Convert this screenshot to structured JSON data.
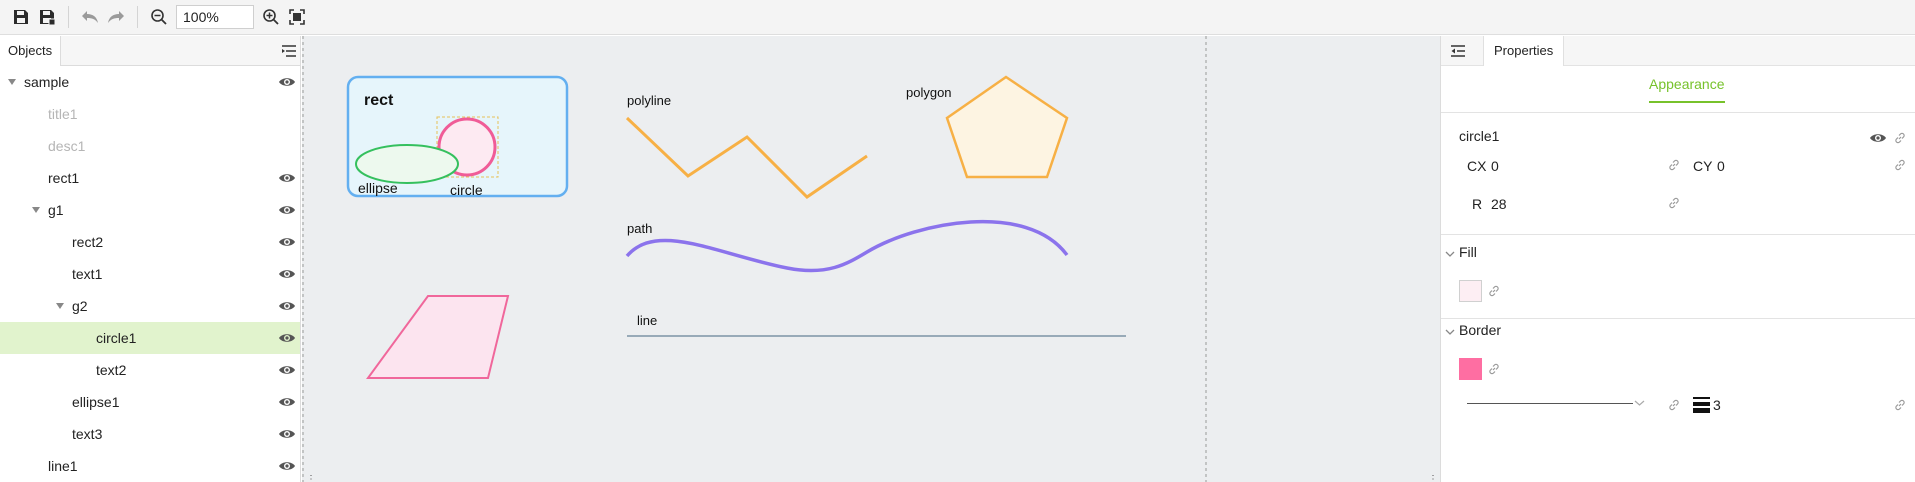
{
  "toolbar": {
    "zoom_value": "100%",
    "icons": [
      "save-icon",
      "save-as-icon",
      "undo-icon",
      "redo-icon",
      "zoom-out-icon",
      "zoom-in-icon",
      "fit-screen-icon"
    ]
  },
  "objects_panel": {
    "tab_label": "Objects",
    "tree": [
      {
        "label": "sample",
        "eye": true
      },
      {
        "label": "title1",
        "eye": false
      },
      {
        "label": "desc1",
        "eye": false
      },
      {
        "label": "rect1",
        "eye": true
      },
      {
        "label": "g1",
        "eye": true
      },
      {
        "label": "rect2",
        "eye": true
      },
      {
        "label": "text1",
        "eye": true
      },
      {
        "label": "g2",
        "eye": true
      },
      {
        "label": "circle1",
        "eye": true,
        "selected": true
      },
      {
        "label": "text2",
        "eye": true
      },
      {
        "label": "ellipse1",
        "eye": true
      },
      {
        "label": "text3",
        "eye": true
      },
      {
        "label": "line1",
        "eye": true
      }
    ]
  },
  "canvas": {
    "labels": {
      "rect": "rect",
      "ellipse": "ellipse",
      "circle": "circle",
      "polyline": "polyline",
      "polygon": "polygon",
      "path": "path",
      "line": "line"
    },
    "colors": {
      "background": "#eceef0",
      "rect_fill": "#e6f5fb",
      "rect_stroke": "#63aff0",
      "ellipse_fill": "#edf9ee",
      "ellipse_stroke": "#35c05e",
      "circle_fill": "#fdeaf2",
      "circle_stroke": "#f05c97",
      "polyline_stroke": "#f7b045",
      "polygon_fill": "#fdf4e2",
      "polygon_stroke": "#f7b045",
      "path_stroke": "#8b73ec",
      "parallelogram_fill": "#fce4ef",
      "parallelogram_stroke": "#f0679b",
      "line_stroke": "#98aab8"
    }
  },
  "properties_panel": {
    "tab_label": "Properties",
    "sub_tab_label": "Appearance",
    "object_name": "circle1",
    "fields": {
      "cx_label": "CX",
      "cx_value": "0",
      "cy_label": "CY",
      "cy_value": "0",
      "r_label": "R",
      "r_value": "28"
    },
    "fill": {
      "title": "Fill",
      "color": "#fdeef3"
    },
    "border": {
      "title": "Border",
      "color": "#fe6ea2",
      "width_value": "3"
    }
  }
}
